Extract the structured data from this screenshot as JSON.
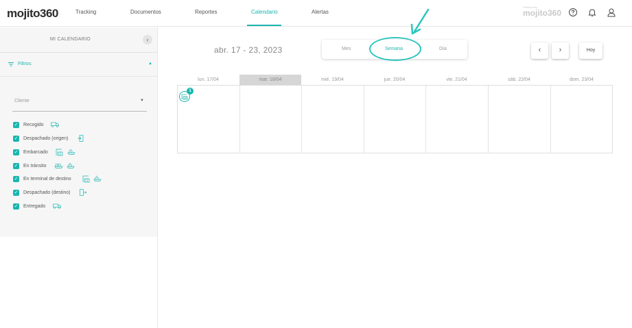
{
  "app": {
    "logo_text": "mojito",
    "logo_num": "360",
    "brand_faded": "mojito360",
    "brand_faded_small": "Powered by"
  },
  "nav": {
    "items": [
      {
        "label": "Tracking"
      },
      {
        "label": "Documentos"
      },
      {
        "label": "Reportes"
      },
      {
        "label": "Calendario",
        "active": true
      },
      {
        "label": "Alertas"
      }
    ]
  },
  "top_icons": [
    "help-icon",
    "bell-icon",
    "user-icon"
  ],
  "sidebar": {
    "title": "MI CALENDARIO",
    "collapse_glyph": "‹",
    "filters_label": "Filtros:",
    "filters_caret": "▲",
    "client_placeholder": "Cliente",
    "client_caret": "▼",
    "filters": [
      {
        "label": "Recogido",
        "checked": true,
        "icons": [
          "truck-icon"
        ]
      },
      {
        "label": "Despachado (origen)",
        "checked": true,
        "icons": [
          "building-exit-icon"
        ]
      },
      {
        "label": "Embarcado",
        "checked": true,
        "icons": [
          "port-crane-icon",
          "ship-icon"
        ]
      },
      {
        "label": "En tránsito",
        "checked": true,
        "icons": [
          "transit-icon",
          "ship-icon"
        ]
      },
      {
        "label": "En terminal de destino",
        "checked": true,
        "icons": [
          "port-crane-icon",
          "ship-icon"
        ]
      },
      {
        "label": "Despachado (destino)",
        "checked": true,
        "icons": [
          "building-exit-icon"
        ]
      },
      {
        "label": "Entregado",
        "checked": true,
        "icons": [
          "truck-icon"
        ]
      }
    ]
  },
  "calendar": {
    "date_range": "abr. 17 - 23, 2023",
    "views": [
      {
        "label": "Mes"
      },
      {
        "label": "Semana",
        "active": true
      },
      {
        "label": "Día"
      }
    ],
    "prev_glyph": "‹",
    "next_glyph": "›",
    "today_label": "Hoy",
    "days": [
      {
        "label": "lun. 17/04"
      },
      {
        "label": "mar. 18/04",
        "today": true
      },
      {
        "label": "mié. 19/04"
      },
      {
        "label": "jue. 20/04"
      },
      {
        "label": "vie. 21/04"
      },
      {
        "label": "sáb. 22/04"
      },
      {
        "label": "dom. 23/04"
      }
    ],
    "event_badge": "1"
  },
  "colors": {
    "accent": "#19b5b0",
    "annotation": "#2cc4be"
  }
}
